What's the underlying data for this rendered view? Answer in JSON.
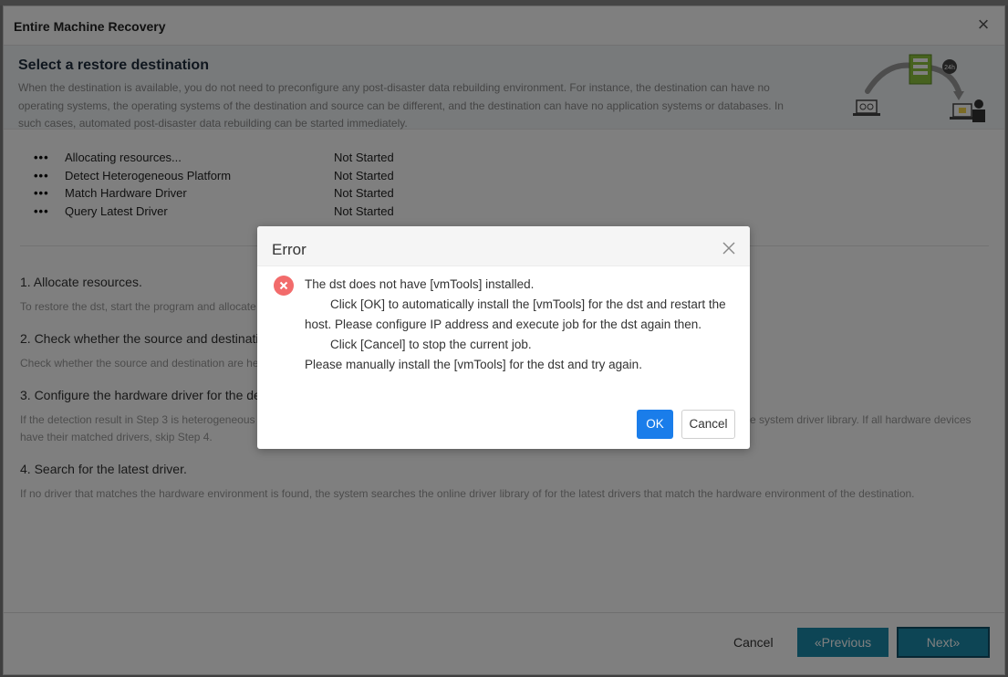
{
  "window": {
    "title": "Entire Machine Recovery"
  },
  "hero": {
    "title": "Select a restore destination",
    "description": "When the destination is available, you do not need to preconfigure any post-disaster data rebuilding environment. For instance, the destination can have no operating systems, the operating systems of the destination and source can be different, and the destination can have no application systems or databases. In such cases, automated post-disaster data rebuilding can be started immediately.",
    "art_badge": "24h"
  },
  "progress": [
    {
      "label": "Allocating resources...",
      "status": "Not Started"
    },
    {
      "label": "Detect Heterogeneous Platform",
      "status": "Not Started"
    },
    {
      "label": "Match Hardware Driver",
      "status": "Not Started"
    },
    {
      "label": "Query Latest Driver",
      "status": "Not Started"
    }
  ],
  "progress_marker": "•••",
  "steps": [
    {
      "title": "1. Allocate resources.",
      "desc": "To restore the dst, start the program and allocate"
    },
    {
      "title": "2. Check whether the source and destinati",
      "desc": "Check whether the source and destination are he"
    },
    {
      "title": "3. Configure the hardware driver for the de",
      "desc": "If the detection result in Step 3 is heterogeneous",
      "desc_right": "e system driver library. If all hardware devices",
      "desc2": "have their matched drivers, skip Step 4."
    },
    {
      "title": "4. Search for the latest driver.",
      "desc": "If no driver that matches the hardware environment is found, the system searches the online driver library of for the latest drivers that match the hardware environment of the destination."
    }
  ],
  "footer": {
    "cancel": "Cancel",
    "previous": "«Previous",
    "next": "Next»"
  },
  "error_dialog": {
    "title": "Error",
    "line1": "The dst does not have [vmTools] installed.",
    "line2": "Click [OK] to automatically install the [vmTools] for the dst and restart the host. Please configure IP address and execute job for the dst again then.",
    "line3": "Click [Cancel] to stop the current job.",
    "line4": "Please manually install the [vmTools] for the dst and try again.",
    "ok": "OK",
    "cancel": "Cancel"
  },
  "colors": {
    "primary_teal": "#1a8bab",
    "ok_blue": "#1a7dea",
    "error_red": "#f26b6b"
  }
}
